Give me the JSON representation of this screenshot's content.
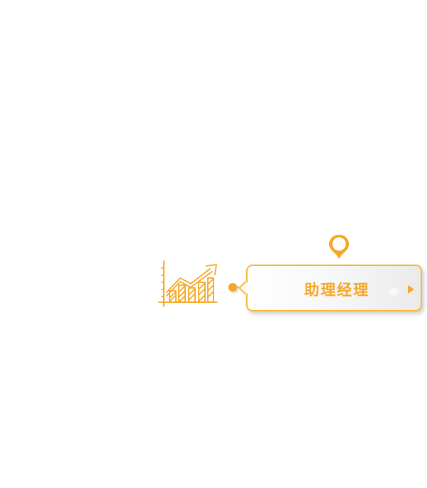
{
  "node": {
    "title": "助理经理"
  },
  "icons": {
    "chart": "growth-chart-icon",
    "pin": "location-pin-icon",
    "arrow": "play-arrow-icon"
  },
  "colors": {
    "accent": "#f5a623",
    "border": "#f5b731",
    "card_bg": "#f4f4f4"
  }
}
